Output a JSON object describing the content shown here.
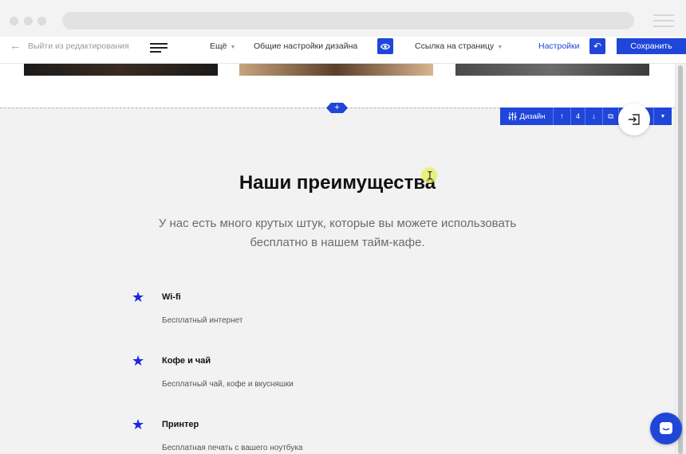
{
  "toolbar": {
    "exit_label": "Выйти из редактирования",
    "more_label": "Ещё",
    "design_settings_label": "Общие настройки дизайна",
    "page_link_label": "Ссылка на страницу",
    "settings_label": "Настройки",
    "save_label": "Сохранить"
  },
  "block_tools": {
    "design_label": "Дизайн",
    "position": "4"
  },
  "section": {
    "title": "Наши преимущества",
    "subtitle_line1": "У нас есть много крутых штук, которые вы можете использовать",
    "subtitle_line2": "бесплатно в нашем тайм-кафе."
  },
  "features": [
    {
      "title": "Wi-fi",
      "desc": "Бесплатный интернет"
    },
    {
      "title": "Кофе и чай",
      "desc": "Бесплатный чай, кофе и вкусняшки"
    },
    {
      "title": "Принтер",
      "desc": "Бесплатная печать с вашего ноутбука"
    }
  ],
  "colors": {
    "accent": "#1f46d8",
    "star": "#1a26e0",
    "section_bg": "#f2f2f2"
  },
  "icons": [
    "arrow-left-icon",
    "menu-icon",
    "eye-icon",
    "undo-icon",
    "sliders-icon",
    "arrow-up-icon",
    "arrow-down-icon",
    "copy-icon",
    "trash-icon",
    "exit-icon",
    "star-icon",
    "chat-icon"
  ]
}
